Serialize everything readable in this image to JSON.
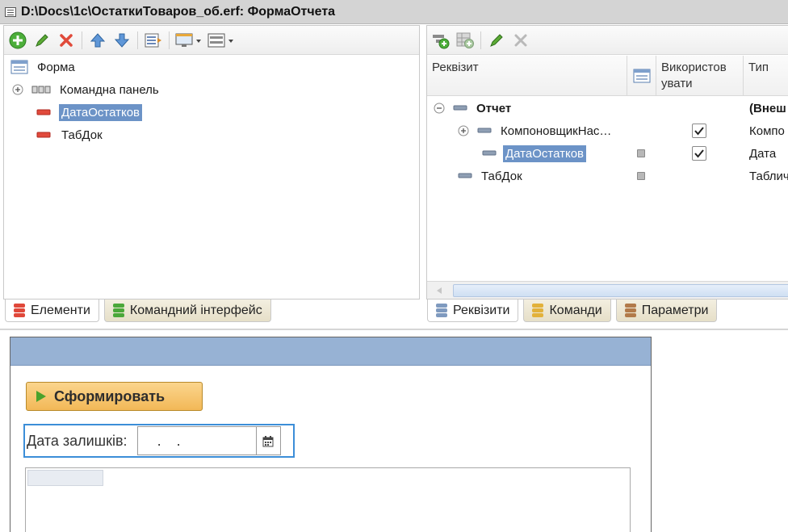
{
  "window": {
    "title": "D:\\Docs\\1c\\ОстаткиТоваров_об.erf: ФормаОтчета"
  },
  "elements_panel": {
    "tree": [
      {
        "label": "Форма"
      },
      {
        "label": "Командна панель"
      },
      {
        "label": "ДатаОстатков",
        "selected": true
      },
      {
        "label": "ТабДок"
      }
    ],
    "tabs": [
      {
        "label": "Елементи",
        "active": true
      },
      {
        "label": "Командний інтерфейс",
        "active": false
      }
    ]
  },
  "props_panel": {
    "columns": {
      "requisite": "Реквізит",
      "use": "Використовувати",
      "type": "Тип"
    },
    "use_header_line1": "Використов",
    "use_header_line2": "увати",
    "rows": [
      {
        "label": "Отчет",
        "type": "(Внеш",
        "bold": true
      },
      {
        "label": "КомпоновщикНас…",
        "type": "Компо",
        "checked": true
      },
      {
        "label": "ДатаОстатков",
        "type": "Дата",
        "checked": true,
        "selected": true
      },
      {
        "label": "ТабДок",
        "type": "Таблич"
      }
    ],
    "tabs": [
      {
        "label": "Реквізити",
        "active": true
      },
      {
        "label": "Команди",
        "active": false
      },
      {
        "label": "Параметри",
        "active": false
      }
    ]
  },
  "form_preview": {
    "generate_button": "Сформировать",
    "date_label": "Дата залишків:",
    "date_value": " .  . "
  },
  "colors": {
    "selection": "#6c93c7",
    "form_header": "#97b2d4",
    "generate_button": "#f2b857",
    "focus_border": "#3c8ed8"
  }
}
